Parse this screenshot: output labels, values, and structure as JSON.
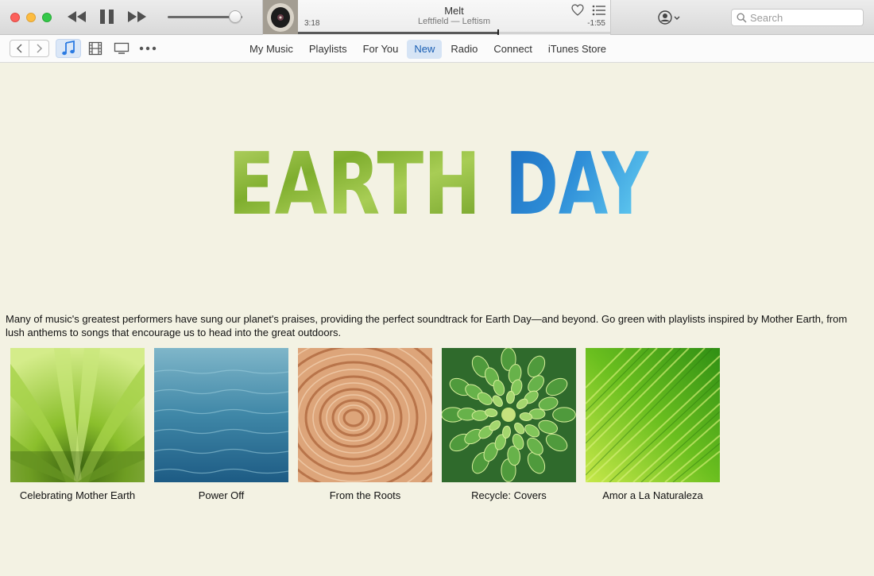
{
  "player": {
    "track_title": "Melt",
    "track_artist": "Leftfield — Leftism",
    "elapsed": "3:18",
    "remaining": "-1:55",
    "progress_fraction": 0.64,
    "volume_fraction": 0.9
  },
  "search": {
    "placeholder": "Search",
    "value": ""
  },
  "nav": {
    "tabs": [
      {
        "label": "My Music",
        "active": false
      },
      {
        "label": "Playlists",
        "active": false
      },
      {
        "label": "For You",
        "active": false
      },
      {
        "label": "New",
        "active": true
      },
      {
        "label": "Radio",
        "active": false
      },
      {
        "label": "Connect",
        "active": false
      },
      {
        "label": "iTunes Store",
        "active": false
      }
    ],
    "media_kinds": [
      "music-icon",
      "movies-icon",
      "tv-icon",
      "more-icon"
    ]
  },
  "hero": {
    "word1": "EARTH",
    "word2": "DAY",
    "word1_color": "#8cb83a",
    "word2_color": "#2a86d3"
  },
  "description": "Many of music's greatest performers have sung our planet's praises, providing the perfect soundtrack for Earth Day—and beyond. Go green with playlists inspired by Mother Earth, from lush anthems to songs that encourage us to head into the great outdoors.",
  "playlists": [
    {
      "title": "Celebrating Mother Earth",
      "art": "green-leaves-artwork"
    },
    {
      "title": "Power Off",
      "art": "ocean-water-artwork"
    },
    {
      "title": "From the Roots",
      "art": "tree-rings-artwork"
    },
    {
      "title": "Recycle: Covers",
      "art": "succulent-artwork"
    },
    {
      "title": "Amor a La Naturaleza",
      "art": "palm-leaf-artwork"
    }
  ],
  "colors": {
    "background": "#f3f2e3",
    "accent": "#1a5fb4",
    "active_tab_bg": "#d6e4f5"
  }
}
